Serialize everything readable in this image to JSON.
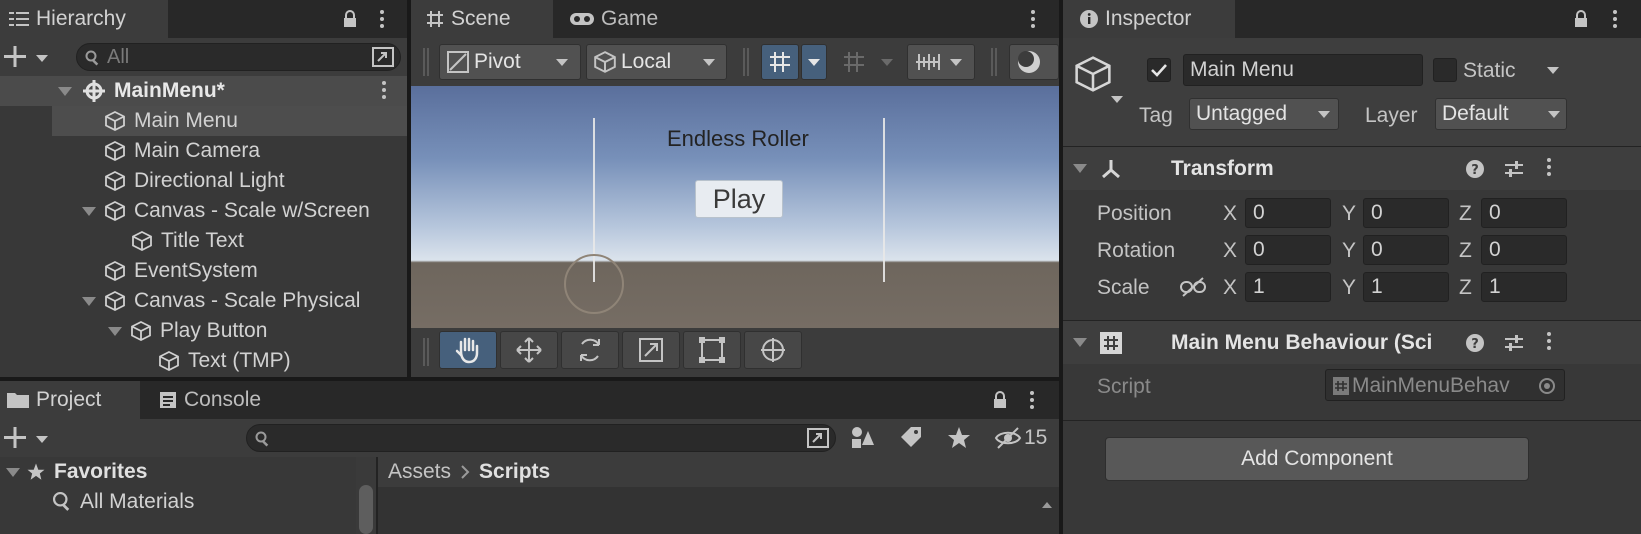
{
  "hierarchy": {
    "tab_label": "Hierarchy",
    "search_placeholder": "All",
    "scene_name": "MainMenu*",
    "items": [
      {
        "label": "Main Menu"
      },
      {
        "label": "Main Camera"
      },
      {
        "label": "Directional Light"
      },
      {
        "label": "Canvas - Scale w/Screen"
      },
      {
        "label": "Title Text"
      },
      {
        "label": "EventSystem"
      },
      {
        "label": "Canvas - Scale Physical"
      },
      {
        "label": "Play Button"
      },
      {
        "label": "Text (TMP)"
      }
    ]
  },
  "scene": {
    "tabs": [
      {
        "label": "Scene"
      },
      {
        "label": "Game"
      }
    ],
    "pivot_label": "Pivot",
    "local_label": "Local",
    "title_text": "Endless Roller",
    "play_label": "Play"
  },
  "project": {
    "tabs": [
      {
        "label": "Project"
      },
      {
        "label": "Console"
      }
    ],
    "hidden_count": "15",
    "favorites_label": "Favorites",
    "all_materials_label": "All Materials",
    "breadcrumb_root": "Assets",
    "breadcrumb_current": "Scripts"
  },
  "inspector": {
    "tab_label": "Inspector",
    "object_name": "Main Menu",
    "static_label": "Static",
    "tag_label": "Tag",
    "tag_value": "Untagged",
    "layer_label": "Layer",
    "layer_value": "Default",
    "transform": {
      "title": "Transform",
      "position_label": "Position",
      "rotation_label": "Rotation",
      "scale_label": "Scale",
      "position": {
        "x": "0",
        "y": "0",
        "z": "0"
      },
      "rotation": {
        "x": "0",
        "y": "0",
        "z": "0"
      },
      "scale": {
        "x": "1",
        "y": "1",
        "z": "1"
      }
    },
    "behaviour": {
      "title": "Main Menu Behaviour (Sci",
      "script_label": "Script",
      "script_value": "MainMenuBehav"
    },
    "add_component_label": "Add Component",
    "axis_labels": {
      "x": "X",
      "y": "Y",
      "z": "Z"
    }
  }
}
